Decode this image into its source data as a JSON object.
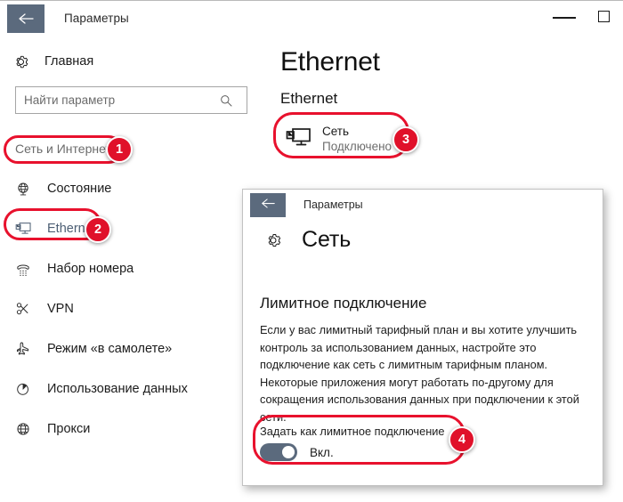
{
  "outer_window": {
    "title": "Параметры",
    "back_icon": "back-arrow-icon",
    "controls": {
      "minimize": "minimize-icon",
      "maximize": "maximize-icon"
    }
  },
  "sidebar": {
    "home": {
      "label": "Главная",
      "icon": "gear-icon"
    },
    "search": {
      "placeholder": "Найти параметр",
      "icon": "search-icon"
    },
    "items": [
      {
        "label": "Сеть и Интернет",
        "icon": "",
        "type": "header"
      },
      {
        "label": "Состояние",
        "icon": "globe-signal-icon",
        "type": "item"
      },
      {
        "label": "Ethernet",
        "icon": "ethernet-monitor-icon",
        "type": "item",
        "selected": true
      },
      {
        "label": "Набор номера",
        "icon": "dialup-phone-icon",
        "type": "item"
      },
      {
        "label": "VPN",
        "icon": "vpn-key-icon",
        "type": "item"
      },
      {
        "label": "Режим «в самолете»",
        "icon": "airplane-icon",
        "type": "item"
      },
      {
        "label": "Использование данных",
        "icon": "pie-chart-icon",
        "type": "item"
      },
      {
        "label": "Прокси",
        "icon": "globe-icon",
        "type": "item"
      }
    ]
  },
  "content": {
    "page_title": "Ethernet",
    "section_title": "Ethernet",
    "network_card": {
      "icon": "ethernet-monitor-icon",
      "name": "Сеть",
      "status": "Подключено"
    }
  },
  "inner_window": {
    "title": "Параметры",
    "back_icon": "back-arrow-icon",
    "header": {
      "icon": "gear-icon",
      "label": "Сеть"
    },
    "section_heading": "Лимитное подключение",
    "paragraph": "Если у вас лимитный тарифный план и вы хотите улучшить контроль за использованием данных, настройте это подключение как сеть с лимитным тарифным планом. Некоторые приложения могут работать по-другому для сокращения использования данных при подключении к этой сети.",
    "setting_label": "Задать как лимитное подключение",
    "toggle": {
      "state": "on",
      "state_text": "Вкл."
    }
  },
  "annotations": {
    "accent_color": "#e0112a",
    "badges": [
      {
        "number": "1",
        "target": "Сеть и Интернет"
      },
      {
        "number": "2",
        "target": "Ethernet"
      },
      {
        "number": "3",
        "target": "Сеть / Подключено"
      },
      {
        "number": "4",
        "target": "Задать как лимитное подключение"
      }
    ]
  },
  "theme": {
    "accent_slate": "#5b6a7d",
    "selected_text": "#4d5f74",
    "muted_text": "#6b6b6b"
  }
}
